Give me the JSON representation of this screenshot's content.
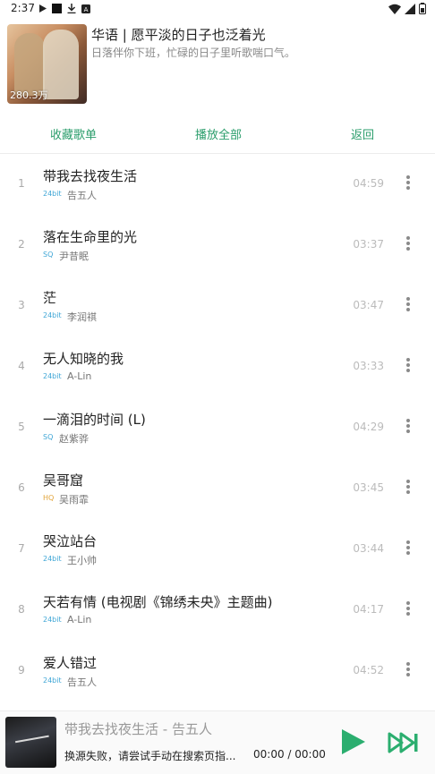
{
  "status_bar": {
    "time": "2:37"
  },
  "playlist": {
    "title": "华语 | 愿平淡的日子也泛着光",
    "description": "日落伴你下班，忙碌的日子里听歌喘口气。",
    "play_count": "280.3万"
  },
  "actions": {
    "collect": "收藏歌单",
    "play_all": "播放全部",
    "back": "返回"
  },
  "quality_colors": {
    "24bit": "#3fa6d6",
    "SQ": "#3fa6d6",
    "HQ": "#e2a43a"
  },
  "accent_color": "#2a9d6b",
  "songs": [
    {
      "index": "1",
      "name": "带我去找夜生活",
      "quality": "24bit",
      "artist": "告五人",
      "duration": "04:59"
    },
    {
      "index": "2",
      "name": "落在生命里的光",
      "quality": "SQ",
      "artist": "尹昔眠",
      "duration": "03:37"
    },
    {
      "index": "3",
      "name": "茫",
      "quality": "24bit",
      "artist": "李润祺",
      "duration": "03:47"
    },
    {
      "index": "4",
      "name": "无人知晓的我",
      "quality": "24bit",
      "artist": "A-Lin",
      "duration": "03:33"
    },
    {
      "index": "5",
      "name": "一滴泪的时间 (L)",
      "quality": "SQ",
      "artist": "赵紫骅",
      "duration": "04:29"
    },
    {
      "index": "6",
      "name": "吴哥窟",
      "quality": "HQ",
      "artist": "吴雨霏",
      "duration": "03:45"
    },
    {
      "index": "7",
      "name": "哭泣站台",
      "quality": "24bit",
      "artist": "王小帅",
      "duration": "03:44"
    },
    {
      "index": "8",
      "name": "天若有情 (电视剧《锦绣未央》主题曲)",
      "quality": "24bit",
      "artist": "A-Lin",
      "duration": "04:17"
    },
    {
      "index": "9",
      "name": "爱人错过",
      "quality": "24bit",
      "artist": "告五人",
      "duration": "04:52"
    }
  ],
  "player": {
    "now_playing": "带我去找夜生活 - 告五人",
    "status": "换源失败，请尝试手动在搜索页指...",
    "time": "00:00 / 00:00"
  }
}
